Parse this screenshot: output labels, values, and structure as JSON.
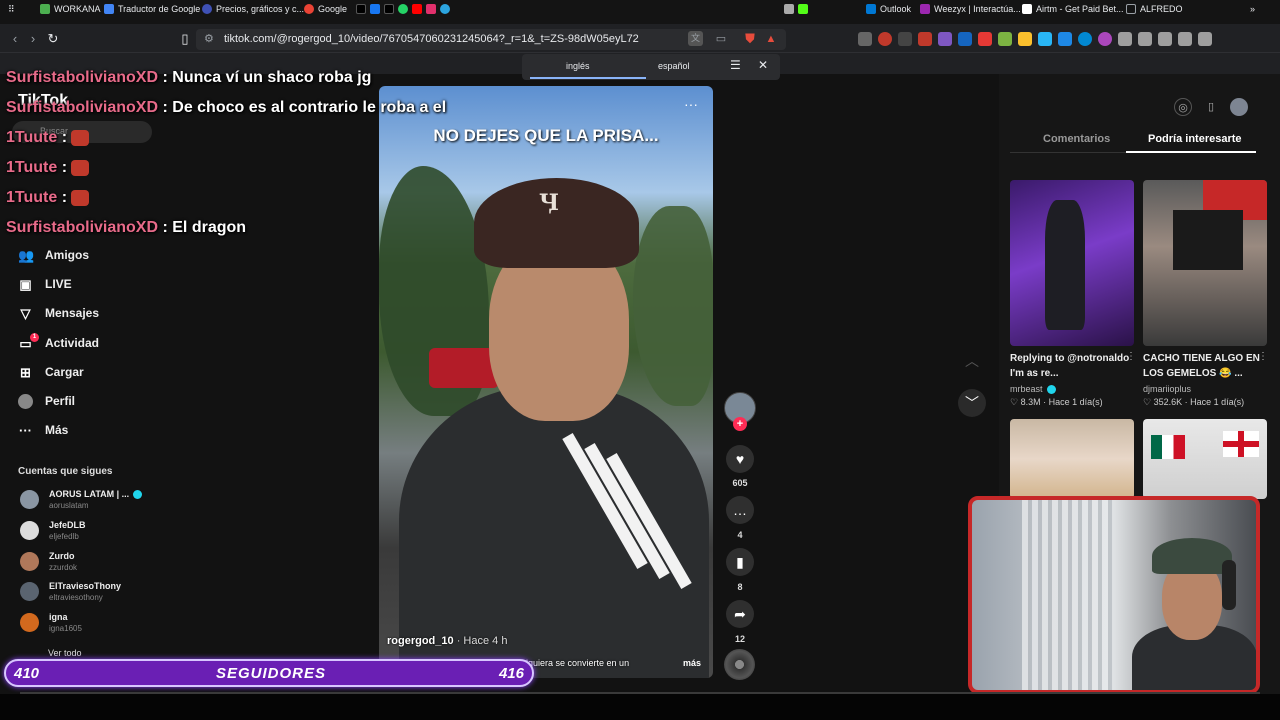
{
  "browser": {
    "url": "tiktok.com/@rogergod_10/video/7670547060231245064?_r=1&_t=ZS-98dW05eyL72",
    "bookmarks": [
      {
        "label": "WORKANA",
        "color": "#4caf50"
      },
      {
        "label": "Traductor de Google",
        "color": "#4285f4"
      },
      {
        "label": "Precios, gráficos y c...",
        "color": "#3f51b5"
      },
      {
        "label": "Google",
        "color": "#ea4335"
      },
      {
        "label": "Outlook",
        "color": "#0078d4"
      },
      {
        "label": "Weezyx | Interactúa...",
        "color": "#9c27b0"
      },
      {
        "label": "Airtm - Get Paid Bet...",
        "color": "#ffffff"
      },
      {
        "label": "ALFREDO",
        "color": "#9aa0a6"
      }
    ],
    "translate_popup": {
      "from": "inglés",
      "to": "español"
    }
  },
  "chat": [
    {
      "user": "SurfistabolivianoXD",
      "message": ": Nunca ví un shaco roba jg"
    },
    {
      "user": "SurfistabolivianoXD",
      "message": ": De choco es al contrario le roba a el"
    },
    {
      "user": "1Tuute",
      "message": ":"
    },
    {
      "user": "1Tuute",
      "message": ":"
    },
    {
      "user": "1Tuute",
      "message": ":"
    },
    {
      "user": "SurfistabolivianoXD",
      "message": ": El dragon"
    }
  ],
  "sidebar": {
    "logo": "TikTok",
    "search_placeholder": "Buscar",
    "items": [
      {
        "label": "Amigos",
        "icon": "friends-icon"
      },
      {
        "label": "LIVE",
        "icon": "live-icon"
      },
      {
        "label": "Mensajes",
        "icon": "send-icon"
      },
      {
        "label": "Actividad",
        "icon": "activity-icon",
        "badge": "1"
      },
      {
        "label": "Cargar",
        "icon": "upload-icon"
      },
      {
        "label": "Perfil",
        "icon": "profile-icon"
      },
      {
        "label": "Más",
        "icon": "more-icon"
      }
    ],
    "following_title": "Cuentas que sigues",
    "following": [
      {
        "name": "AORUS LATAM | ...",
        "handle": "aoruslatam",
        "verified": true,
        "color": "#8a96a3"
      },
      {
        "name": "JefeDLB",
        "handle": "eljefedlb",
        "verified": false,
        "color": "#dddddd"
      },
      {
        "name": "Zurdo",
        "handle": "zzurdok",
        "verified": false,
        "color": "#b0785a"
      },
      {
        "name": "ElTraviesoThony",
        "handle": "eltraviesothony",
        "verified": false,
        "color": "#5a6470"
      },
      {
        "name": "igna",
        "handle": "igna1605",
        "verified": false,
        "color": "#d2691e"
      }
    ],
    "see_all": "Ver todo"
  },
  "video": {
    "caption_overlay": "NO DEJES QUE LA PRISA...",
    "author": "rogergod_10",
    "time": "· Hace 4 h",
    "description": "alquiera se convierte en un",
    "more": "más",
    "likes": "605",
    "comments": "4",
    "saves": "8",
    "shares": "12"
  },
  "right_panel": {
    "tabs": [
      {
        "label": "Comentarios",
        "active": false
      },
      {
        "label": "Podría interesarte",
        "active": true
      }
    ],
    "cards": [
      {
        "title": "Replying to @notronaldo I'm as re...",
        "author": "mrbeast",
        "verified": true,
        "likes": "♡ 8.3M",
        "time": "· Hace 1 día(s)"
      },
      {
        "title": "CACHO TIENE ALGO EN LOS GEMELOS 😂 ...",
        "author": "djmariioplus",
        "verified": false,
        "likes": "♡ 352.6K",
        "time": "· Hace 1 día(s)"
      }
    ]
  },
  "followers_bar": {
    "current": "410",
    "label": "SEGUIDORES",
    "goal": "416"
  }
}
